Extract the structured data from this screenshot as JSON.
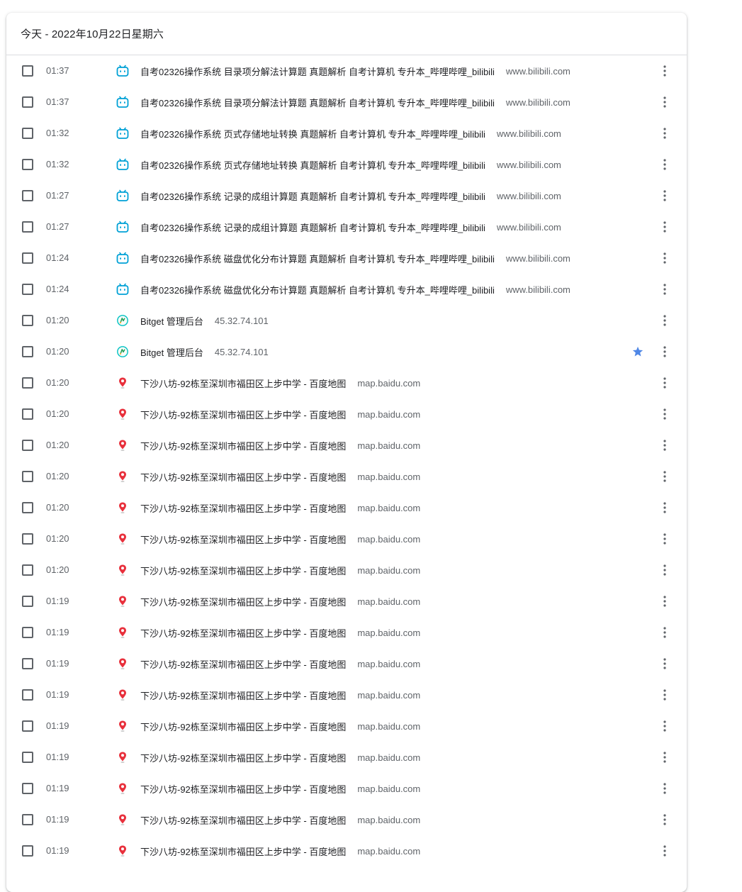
{
  "header": {
    "title": "今天 - 2022年10月22日星期六"
  },
  "colors": {
    "bilibili_icon": "#00a1d6",
    "baidu_map_pin": "#e8303c",
    "bitget_ring": "#00c2c2",
    "star": "#4f87e6",
    "checkbox_border": "#5f6368",
    "secondary_text": "#5f6368"
  },
  "rows": [
    {
      "time": "01:37",
      "icon": "bilibili-icon",
      "title": "自考02326操作系统 目录项分解法计算题 真题解析 自考计算机 专升本_哔哩哔哩_bilibili",
      "domain": "www.bilibili.com",
      "starred": false
    },
    {
      "time": "01:37",
      "icon": "bilibili-icon",
      "title": "自考02326操作系统 目录项分解法计算题 真题解析 自考计算机 专升本_哔哩哔哩_bilibili",
      "domain": "www.bilibili.com",
      "starred": false
    },
    {
      "time": "01:32",
      "icon": "bilibili-icon",
      "title": "自考02326操作系统 页式存储地址转换 真题解析 自考计算机 专升本_哔哩哔哩_bilibili",
      "domain": "www.bilibili.com",
      "starred": false
    },
    {
      "time": "01:32",
      "icon": "bilibili-icon",
      "title": "自考02326操作系统 页式存储地址转换 真题解析 自考计算机 专升本_哔哩哔哩_bilibili",
      "domain": "www.bilibili.com",
      "starred": false
    },
    {
      "time": "01:27",
      "icon": "bilibili-icon",
      "title": "自考02326操作系统 记录的成组计算题 真题解析 自考计算机 专升本_哔哩哔哩_bilibili",
      "domain": "www.bilibili.com",
      "starred": false
    },
    {
      "time": "01:27",
      "icon": "bilibili-icon",
      "title": "自考02326操作系统 记录的成组计算题 真题解析 自考计算机 专升本_哔哩哔哩_bilibili",
      "domain": "www.bilibili.com",
      "starred": false
    },
    {
      "time": "01:24",
      "icon": "bilibili-icon",
      "title": "自考02326操作系统 磁盘优化分布计算题 真题解析 自考计算机 专升本_哔哩哔哩_bilibili",
      "domain": "www.bilibili.com",
      "starred": false
    },
    {
      "time": "01:24",
      "icon": "bilibili-icon",
      "title": "自考02326操作系统 磁盘优化分布计算题 真题解析 自考计算机 专升本_哔哩哔哩_bilibili",
      "domain": "www.bilibili.com",
      "starred": false
    },
    {
      "time": "01:20",
      "icon": "bitget-icon",
      "title": "Bitget 管理后台",
      "domain": "45.32.74.101",
      "starred": false
    },
    {
      "time": "01:20",
      "icon": "bitget-icon",
      "title": "Bitget 管理后台",
      "domain": "45.32.74.101",
      "starred": true
    },
    {
      "time": "01:20",
      "icon": "baidu-map-pin-icon",
      "title": "下沙八坊-92栋至深圳市福田区上步中学 - 百度地图",
      "domain": "map.baidu.com",
      "starred": false
    },
    {
      "time": "01:20",
      "icon": "baidu-map-pin-icon",
      "title": "下沙八坊-92栋至深圳市福田区上步中学 - 百度地图",
      "domain": "map.baidu.com",
      "starred": false
    },
    {
      "time": "01:20",
      "icon": "baidu-map-pin-icon",
      "title": "下沙八坊-92栋至深圳市福田区上步中学 - 百度地图",
      "domain": "map.baidu.com",
      "starred": false
    },
    {
      "time": "01:20",
      "icon": "baidu-map-pin-icon",
      "title": "下沙八坊-92栋至深圳市福田区上步中学 - 百度地图",
      "domain": "map.baidu.com",
      "starred": false
    },
    {
      "time": "01:20",
      "icon": "baidu-map-pin-icon",
      "title": "下沙八坊-92栋至深圳市福田区上步中学 - 百度地图",
      "domain": "map.baidu.com",
      "starred": false
    },
    {
      "time": "01:20",
      "icon": "baidu-map-pin-icon",
      "title": "下沙八坊-92栋至深圳市福田区上步中学 - 百度地图",
      "domain": "map.baidu.com",
      "starred": false
    },
    {
      "time": "01:20",
      "icon": "baidu-map-pin-icon",
      "title": "下沙八坊-92栋至深圳市福田区上步中学 - 百度地图",
      "domain": "map.baidu.com",
      "starred": false
    },
    {
      "time": "01:19",
      "icon": "baidu-map-pin-icon",
      "title": "下沙八坊-92栋至深圳市福田区上步中学 - 百度地图",
      "domain": "map.baidu.com",
      "starred": false
    },
    {
      "time": "01:19",
      "icon": "baidu-map-pin-icon",
      "title": "下沙八坊-92栋至深圳市福田区上步中学 - 百度地图",
      "domain": "map.baidu.com",
      "starred": false
    },
    {
      "time": "01:19",
      "icon": "baidu-map-pin-icon",
      "title": "下沙八坊-92栋至深圳市福田区上步中学 - 百度地图",
      "domain": "map.baidu.com",
      "starred": false
    },
    {
      "time": "01:19",
      "icon": "baidu-map-pin-icon",
      "title": "下沙八坊-92栋至深圳市福田区上步中学 - 百度地图",
      "domain": "map.baidu.com",
      "starred": false
    },
    {
      "time": "01:19",
      "icon": "baidu-map-pin-icon",
      "title": "下沙八坊-92栋至深圳市福田区上步中学 - 百度地图",
      "domain": "map.baidu.com",
      "starred": false
    },
    {
      "time": "01:19",
      "icon": "baidu-map-pin-icon",
      "title": "下沙八坊-92栋至深圳市福田区上步中学 - 百度地图",
      "domain": "map.baidu.com",
      "starred": false
    },
    {
      "time": "01:19",
      "icon": "baidu-map-pin-icon",
      "title": "下沙八坊-92栋至深圳市福田区上步中学 - 百度地图",
      "domain": "map.baidu.com",
      "starred": false
    },
    {
      "time": "01:19",
      "icon": "baidu-map-pin-icon",
      "title": "下沙八坊-92栋至深圳市福田区上步中学 - 百度地图",
      "domain": "map.baidu.com",
      "starred": false
    },
    {
      "time": "01:19",
      "icon": "baidu-map-pin-icon",
      "title": "下沙八坊-92栋至深圳市福田区上步中学 - 百度地图",
      "domain": "map.baidu.com",
      "starred": false
    }
  ]
}
